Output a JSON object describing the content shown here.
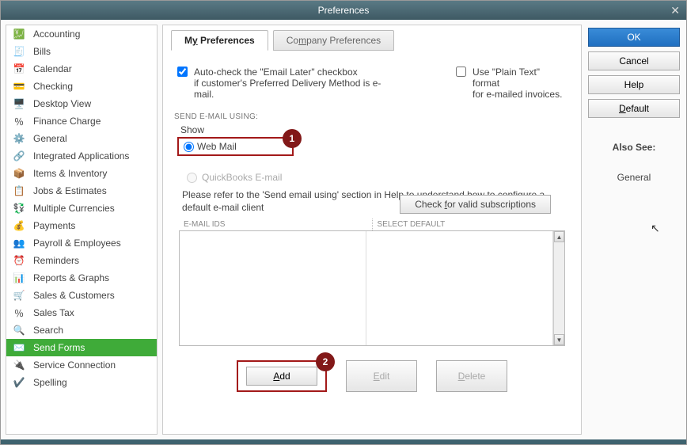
{
  "window": {
    "title": "Preferences"
  },
  "sidebar": {
    "items": [
      {
        "label": "Accounting",
        "icon": "💹"
      },
      {
        "label": "Bills",
        "icon": "🧾"
      },
      {
        "label": "Calendar",
        "icon": "📅"
      },
      {
        "label": "Checking",
        "icon": "💳"
      },
      {
        "label": "Desktop View",
        "icon": "🖥️"
      },
      {
        "label": "Finance Charge",
        "icon": "％"
      },
      {
        "label": "General",
        "icon": "⚙️"
      },
      {
        "label": "Integrated Applications",
        "icon": "🔗"
      },
      {
        "label": "Items & Inventory",
        "icon": "📦"
      },
      {
        "label": "Jobs & Estimates",
        "icon": "📋"
      },
      {
        "label": "Multiple Currencies",
        "icon": "💱"
      },
      {
        "label": "Payments",
        "icon": "💰"
      },
      {
        "label": "Payroll & Employees",
        "icon": "👥"
      },
      {
        "label": "Reminders",
        "icon": "⏰"
      },
      {
        "label": "Reports & Graphs",
        "icon": "📊"
      },
      {
        "label": "Sales & Customers",
        "icon": "🛒"
      },
      {
        "label": "Sales Tax",
        "icon": "％"
      },
      {
        "label": "Search",
        "icon": "🔍"
      },
      {
        "label": "Send Forms",
        "icon": "✉️",
        "active": true
      },
      {
        "label": "Service Connection",
        "icon": "🔌"
      },
      {
        "label": "Spelling",
        "icon": "✔️"
      }
    ]
  },
  "tabs": {
    "my": {
      "pre": "M",
      "u": "y",
      "post": " Preferences"
    },
    "company": {
      "pre": "Co",
      "u": "m",
      "post": "pany Preferences"
    }
  },
  "checks": {
    "auto_check": {
      "line1": "Auto-check the \"Email Later\" checkbox",
      "line2_pre": "if customer's ",
      "line2_u": "P",
      "line2_post": "referred Delivery Method is e-mail.",
      "checked": true
    },
    "plain_text": {
      "line1": "Use \"Plain Text\" format",
      "line2": "for e-mailed invoices.",
      "checked": false
    }
  },
  "section_email_using": "SEND E-MAIL USING:",
  "show_label": "Show",
  "radios": {
    "webmail": {
      "pre": "",
      "u": "W",
      "post": "eb Mail",
      "selected": true
    },
    "qbmail": {
      "label": "QuickBooks E-mail",
      "selected": false
    }
  },
  "buttons": {
    "check_sub": {
      "pre": "Check ",
      "u": "f",
      "post": "or valid subscriptions"
    },
    "add": {
      "pre": "",
      "u": "A",
      "post": "dd"
    },
    "edit": {
      "pre": "",
      "u": "E",
      "post": "dit"
    },
    "delete": {
      "pre": "",
      "u": "D",
      "post": "elete"
    },
    "ok": "OK",
    "cancel": "Cancel",
    "help": "Help",
    "default": {
      "pre": "",
      "u": "D",
      "post": "efault"
    }
  },
  "help_text": "Please refer to the 'Send email using' section in Help to understand how to configure a default e-mail client",
  "table_headers": {
    "col1": "E-MAIL IDS",
    "col2": "SELECT DEFAULT"
  },
  "also_see": {
    "head": "Also See:",
    "item": "General"
  },
  "callouts": {
    "c1": "1",
    "c2": "2"
  }
}
